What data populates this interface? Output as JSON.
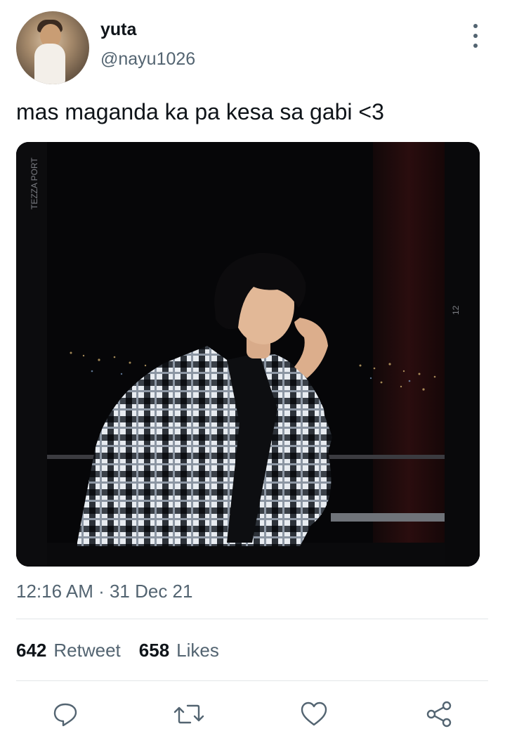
{
  "user": {
    "display_name": "yuta",
    "handle": "@nayu1026"
  },
  "tweet": {
    "text": "mas maganda ka pa kesa sa gabi <3",
    "timestamp": "12:16 AM · 31 Dec 21"
  },
  "media": {
    "frame_text_left": "TEZZA PORT",
    "frame_number_right": "12"
  },
  "stats": {
    "retweet_count": "642",
    "retweet_label": "Retweet",
    "likes_count": "658",
    "likes_label": "Likes"
  },
  "icons": {
    "more": "more-vertical-icon",
    "reply": "reply-icon",
    "retweet": "retweet-icon",
    "like": "heart-icon",
    "share": "share-icon"
  },
  "colors": {
    "text_primary": "#0f1419",
    "text_secondary": "#536471",
    "divider": "#e3e6e8"
  }
}
